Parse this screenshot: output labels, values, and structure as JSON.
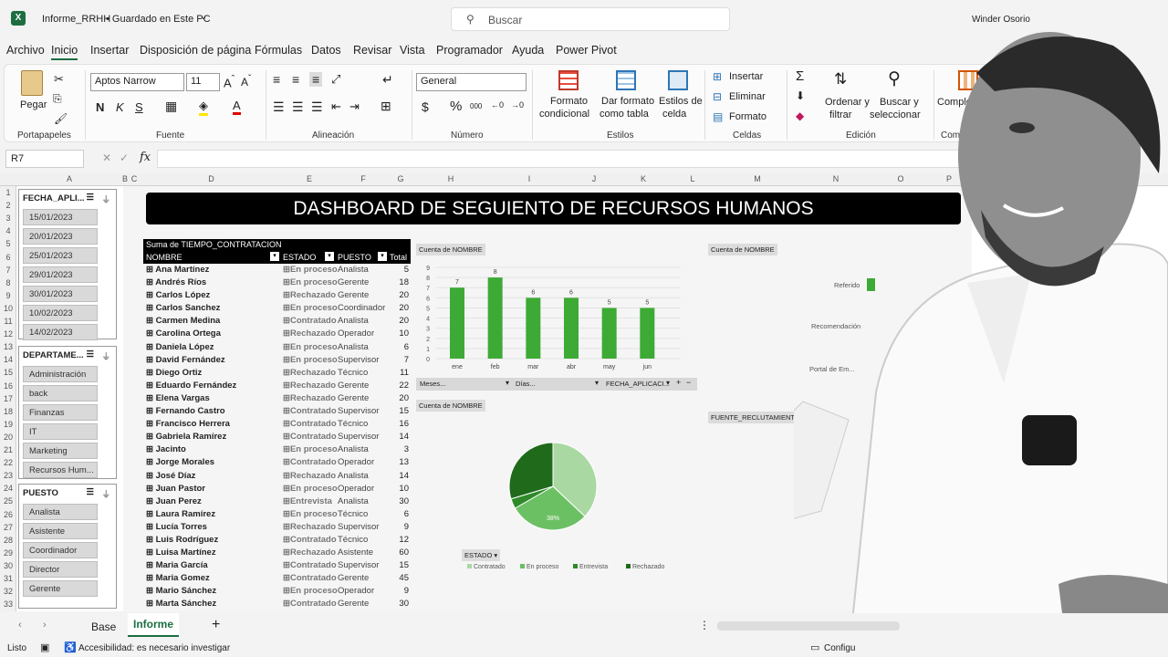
{
  "app": {
    "doc_title": "Informe_RRHH",
    "save_state": "• Guardado en Este PC",
    "search_placeholder": "Buscar",
    "user": "Winder Osorio"
  },
  "menu": [
    "Archivo",
    "Inicio",
    "Insertar",
    "Disposición de página",
    "Fórmulas",
    "Datos",
    "Revisar",
    "Vista",
    "Programador",
    "Ayuda",
    "Power Pivot"
  ],
  "ribbon": {
    "paste": "Pegar",
    "portapapeles": "Portapapeles",
    "font_name": "Aptos Narrow",
    "font_size": "11",
    "fuente": "Fuente",
    "alineacion": "Alineación",
    "number_format": "General",
    "numero": "Número",
    "cond_format_1": "Formato",
    "cond_format_2": "condicional",
    "table_format_1": "Dar formato",
    "table_format_2": "como tabla",
    "cell_styles_1": "Estilos de",
    "cell_styles_2": "celda",
    "estilos": "Estilos",
    "insert": "Insertar",
    "delete": "Eliminar",
    "format": "Formato",
    "celdas": "Celdas",
    "sort_1": "Ordenar y",
    "sort_2": "filtrar",
    "find_1": "Buscar y",
    "find_2": "seleccionar",
    "edicion": "Edición",
    "addins": "Complemen",
    "addins_group": "Compleme"
  },
  "formula_bar": {
    "name_box": "R7",
    "fx": "fx"
  },
  "columns": [
    "A",
    "B",
    "C",
    "D",
    "E",
    "F",
    "G",
    "H",
    "I",
    "J",
    "K",
    "L",
    "M",
    "N",
    "O",
    "P"
  ],
  "rows": [
    "1",
    "2",
    "3",
    "4",
    "5",
    "6",
    "7",
    "8",
    "9",
    "10",
    "11",
    "12",
    "13",
    "14",
    "15",
    "16",
    "17",
    "18",
    "19",
    "20",
    "21",
    "22",
    "23",
    "24",
    "25",
    "26",
    "27",
    "28",
    "29",
    "30",
    "31",
    "32",
    "33"
  ],
  "slicers": [
    {
      "title": "FECHA_APLI...",
      "items": [
        "15/01/2023",
        "20/01/2023",
        "25/01/2023",
        "29/01/2023",
        "30/01/2023",
        "10/02/2023",
        "14/02/2023"
      ]
    },
    {
      "title": "DEPARTAME...",
      "items": [
        "Administración",
        "back",
        "Finanzas",
        "IT",
        "Marketing",
        "Recursos Hum..."
      ]
    },
    {
      "title": "PUESTO",
      "items": [
        "Analista",
        "Asistente",
        "Coordinador",
        "Director",
        "Gerente"
      ]
    }
  ],
  "banner": "DASHBOARD DE SEGUIENTO DE RECURSOS HUMANOS",
  "pivot": {
    "caption": "Suma de TIEMPO_CONTRATACION",
    "headers": [
      "NOMBRE",
      "ESTADO",
      "PUESTO",
      "Total"
    ],
    "rows": [
      [
        "Ana Martínez",
        "En proceso",
        "Analista",
        "5"
      ],
      [
        "Andrés Ríos",
        "En proceso",
        "Gerente",
        "18"
      ],
      [
        "Carlos López",
        "Rechazado",
        "Gerente",
        "20"
      ],
      [
        "Carlos Sanchez",
        "En proceso",
        "Coordinador",
        "20"
      ],
      [
        "Carmen Medina",
        "Contratado",
        "Analista",
        "20"
      ],
      [
        "Carolina Ortega",
        "Rechazado",
        "Operador",
        "10"
      ],
      [
        "Daniela López",
        "En proceso",
        "Analista",
        "6"
      ],
      [
        "David Fernández",
        "En proceso",
        "Supervisor",
        "7"
      ],
      [
        "Diego Ortiz",
        "Rechazado",
        "Técnico",
        "11"
      ],
      [
        "Eduardo Fernández",
        "Rechazado",
        "Gerente",
        "22"
      ],
      [
        "Elena Vargas",
        "Rechazado",
        "Gerente",
        "20"
      ],
      [
        "Fernando Castro",
        "Contratado",
        "Supervisor",
        "15"
      ],
      [
        "Francisco Herrera",
        "Contratado",
        "Técnico",
        "16"
      ],
      [
        "Gabriela Ramírez",
        "Contratado",
        "Supervisor",
        "14"
      ],
      [
        "Jacinto",
        "En proceso",
        "Analista",
        "3"
      ],
      [
        "Jorge Morales",
        "Contratado",
        "Operador",
        "13"
      ],
      [
        "José Díaz",
        "Rechazado",
        "Analista",
        "14"
      ],
      [
        "Juan Pastor",
        "En proceso",
        "Operador",
        "10"
      ],
      [
        "Juan Perez",
        "Entrevista",
        "Analista",
        "30"
      ],
      [
        "Laura Ramírez",
        "En proceso",
        "Técnico",
        "6"
      ],
      [
        "Lucía Torres",
        "Rechazado",
        "Supervisor",
        "9"
      ],
      [
        "Luis Rodríguez",
        "Contratado",
        "Técnico",
        "12"
      ],
      [
        "Luisa Martínez",
        "Rechazado",
        "Asistente",
        "60"
      ],
      [
        "Maria García",
        "Contratado",
        "Supervisor",
        "15"
      ],
      [
        "Maria Gomez",
        "Contratado",
        "Gerente",
        "45"
      ],
      [
        "Mario Sánchez",
        "En proceso",
        "Operador",
        "9"
      ],
      [
        "Marta Sánchez",
        "Contratado",
        "Gerente",
        "30"
      ]
    ]
  },
  "bar_chart": {
    "tag": "Cuenta de NOMBRE",
    "filters": [
      "Meses...",
      "Días...",
      "FECHA_APLICACI..."
    ],
    "color": "#3daa35"
  },
  "pie_chart": {
    "tag": "Cuenta de NOMBRE",
    "filter": "ESTADO",
    "slice_label": "38%"
  },
  "right_chart": {
    "tag": "Cuenta de NOMBRE",
    "filter": "FUENTE_RECLUTAMIENTO",
    "categories": [
      "Referido",
      "Recomendación",
      "Portal de Em..."
    ],
    "axis_ticks": [
      "0",
      "2"
    ]
  },
  "chart_data": [
    {
      "type": "bar",
      "categories": [
        "ene",
        "feb",
        "mar",
        "abr",
        "may",
        "jun"
      ],
      "values": [
        7,
        8,
        6,
        6,
        5,
        5
      ],
      "ylim": [
        0,
        9
      ],
      "yticks": [
        "0",
        "1",
        "2",
        "3",
        "4",
        "5",
        "6",
        "7",
        "8",
        "9"
      ],
      "grid": true
    },
    {
      "type": "pie",
      "categories": [
        "Contratado",
        "En proceso",
        "Entrevista",
        "Rechazado"
      ],
      "values": [
        10,
        8,
        1,
        8
      ],
      "colors": [
        "#a9d8a2",
        "#6cc064",
        "#2f8a2a",
        "#1f6b1b"
      ],
      "legend": "bottom"
    }
  ],
  "sheets": [
    "Base",
    "Informe"
  ],
  "status": {
    "ready": "Listo",
    "accessibility": "Accesibilidad: es necesario investigar",
    "config": "Configu"
  }
}
